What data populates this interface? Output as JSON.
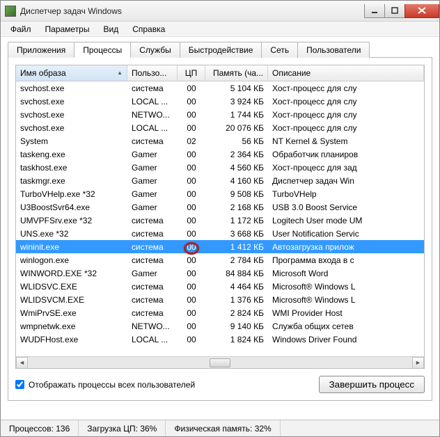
{
  "window": {
    "title": "Диспетчер задач Windows"
  },
  "menu": {
    "file": "Файл",
    "options": "Параметры",
    "view": "Вид",
    "help": "Справка"
  },
  "tabs": {
    "apps": "Приложения",
    "processes": "Процессы",
    "services": "Службы",
    "perf": "Быстродействие",
    "net": "Сеть",
    "users": "Пользователи"
  },
  "columns": {
    "image": "Имя образа",
    "user": "Пользо...",
    "cpu": "ЦП",
    "mem": "Память (ча...",
    "desc": "Описание"
  },
  "rows": [
    {
      "image": "svchost.exe",
      "user": "система",
      "cpu": "00",
      "mem": "5 104 КБ",
      "desc": "Хост-процесс для слу"
    },
    {
      "image": "svchost.exe",
      "user": "LOCAL ...",
      "cpu": "00",
      "mem": "3 924 КБ",
      "desc": "Хост-процесс для слу"
    },
    {
      "image": "svchost.exe",
      "user": "NETWO...",
      "cpu": "00",
      "mem": "1 744 КБ",
      "desc": "Хост-процесс для слу"
    },
    {
      "image": "svchost.exe",
      "user": "LOCAL ...",
      "cpu": "00",
      "mem": "20 076 КБ",
      "desc": "Хост-процесс для слу"
    },
    {
      "image": "System",
      "user": "система",
      "cpu": "02",
      "mem": "56 КБ",
      "desc": "NT Kernel & System"
    },
    {
      "image": "taskeng.exe",
      "user": "Gamer",
      "cpu": "00",
      "mem": "2 364 КБ",
      "desc": "Обработчик планиров"
    },
    {
      "image": "taskhost.exe",
      "user": "Gamer",
      "cpu": "00",
      "mem": "4 560 КБ",
      "desc": "Хост-процесс для зад"
    },
    {
      "image": "taskmgr.exe",
      "user": "Gamer",
      "cpu": "00",
      "mem": "4 160 КБ",
      "desc": "Диспетчер задач Win"
    },
    {
      "image": "TurboVHelp.exe *32",
      "user": "Gamer",
      "cpu": "00",
      "mem": "9 508 КБ",
      "desc": "TurboVHelp"
    },
    {
      "image": "U3BoostSvr64.exe",
      "user": "Gamer",
      "cpu": "00",
      "mem": "2 168 КБ",
      "desc": "USB 3.0 Boost Service"
    },
    {
      "image": "UMVPFSrv.exe *32",
      "user": "система",
      "cpu": "00",
      "mem": "1 172 КБ",
      "desc": "Logitech User mode UM"
    },
    {
      "image": "UNS.exe *32",
      "user": "система",
      "cpu": "00",
      "mem": "3 668 КБ",
      "desc": "User Notification Servic"
    },
    {
      "image": "wininit.exe",
      "user": "система",
      "cpu": "00",
      "mem": "1 412 КБ",
      "desc": "Автозагрузка прилож",
      "selected": true
    },
    {
      "image": "winlogon.exe",
      "user": "система",
      "cpu": "00",
      "mem": "2 784 КБ",
      "desc": "Программа входа в с"
    },
    {
      "image": "WINWORD.EXE *32",
      "user": "Gamer",
      "cpu": "00",
      "mem": "84 884 КБ",
      "desc": "Microsoft Word"
    },
    {
      "image": "WLIDSVC.EXE",
      "user": "система",
      "cpu": "00",
      "mem": "4 464 КБ",
      "desc": "Microsoft® Windows L"
    },
    {
      "image": "WLIDSVCM.EXE",
      "user": "система",
      "cpu": "00",
      "mem": "1 376 КБ",
      "desc": "Microsoft® Windows L"
    },
    {
      "image": "WmiPrvSE.exe",
      "user": "система",
      "cpu": "00",
      "mem": "2 824 КБ",
      "desc": "WMI Provider Host"
    },
    {
      "image": "wmpnetwk.exe",
      "user": "NETWO...",
      "cpu": "00",
      "mem": "9 140 КБ",
      "desc": "Служба общих сетев"
    },
    {
      "image": "WUDFHost.exe",
      "user": "LOCAL ...",
      "cpu": "00",
      "mem": "1 824 КБ",
      "desc": "Windows Driver Found"
    }
  ],
  "checkbox": {
    "label": "Отображать процессы всех пользователей",
    "checked": true
  },
  "button_end": "Завершить процесс",
  "status": {
    "procs_label": "Процессов:",
    "procs_val": "136",
    "cpu_label": "Загрузка ЦП:",
    "cpu_val": "36%",
    "mem_label": "Физическая память:",
    "mem_val": "32%"
  },
  "annotation": {
    "ring_target_row": 12
  }
}
